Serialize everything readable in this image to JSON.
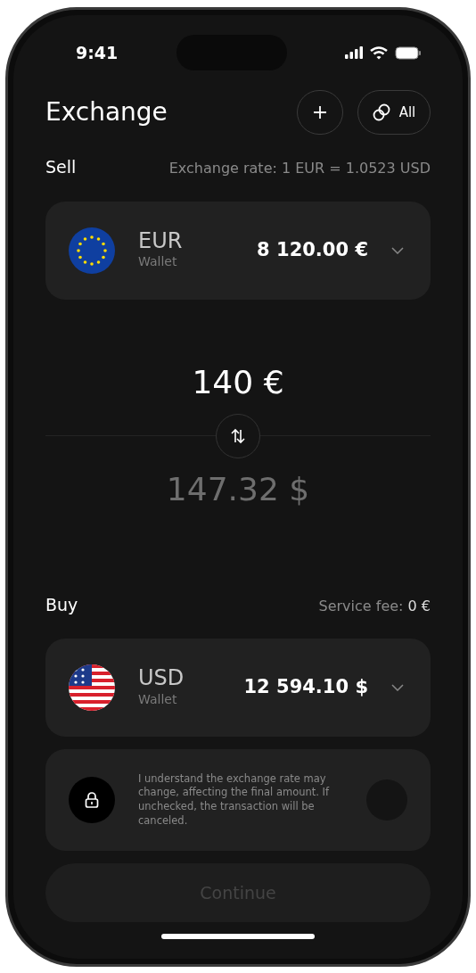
{
  "status_bar": {
    "time": "9:41"
  },
  "header": {
    "title": "Exchange",
    "all_label": "All"
  },
  "sell": {
    "label": "Sell",
    "rate": "Exchange rate: 1 EUR = 1.0523 USD",
    "wallet": {
      "kind": "eu",
      "currency": "EUR",
      "subtitle": "Wallet",
      "balance": "8 120.00 €"
    }
  },
  "amounts": {
    "sell": "140 €",
    "buy": "147.32 $"
  },
  "buy": {
    "label": "Buy",
    "fee_label": "Service fee:",
    "fee_value": "0 €",
    "wallet": {
      "kind": "us",
      "currency": "USD",
      "subtitle": "Wallet",
      "balance": "12 594.10 $"
    }
  },
  "consent": {
    "text": "I understand the exchange rate may change, affecting the final amount. If unchecked, the transaction will be canceled.",
    "checked": false
  },
  "continue_button": {
    "label": "Continue",
    "disabled": true
  }
}
